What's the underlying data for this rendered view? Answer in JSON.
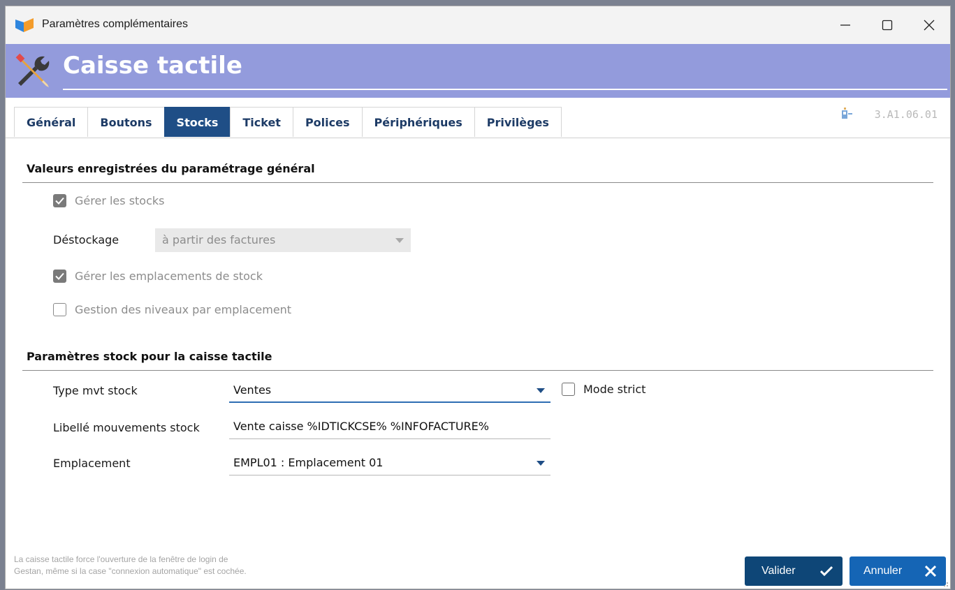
{
  "window": {
    "title": "Paramètres complémentaires"
  },
  "banner": {
    "title": "Caisse tactile"
  },
  "version": "3.A1.06.01",
  "tabs": [
    {
      "label": "Général",
      "active": false
    },
    {
      "label": "Boutons",
      "active": false
    },
    {
      "label": "Stocks",
      "active": true
    },
    {
      "label": "Ticket",
      "active": false
    },
    {
      "label": "Polices",
      "active": false
    },
    {
      "label": "Périphériques",
      "active": false
    },
    {
      "label": "Privilèges",
      "active": false
    }
  ],
  "general_section": {
    "title": "Valeurs enregistrées du paramétrage général",
    "gerer_stocks": {
      "label": "Gérer les stocks",
      "checked": true
    },
    "destockage": {
      "label": "Déstockage",
      "value": "à partir des factures"
    },
    "gerer_emplacements": {
      "label": "Gérer les emplacements de stock",
      "checked": true
    },
    "gestion_niveaux": {
      "label": "Gestion des niveaux par emplacement",
      "checked": false
    }
  },
  "stock_section": {
    "title": "Paramètres stock pour la caisse tactile",
    "type_mvt": {
      "label": "Type mvt stock",
      "value": "Ventes"
    },
    "mode_strict": {
      "label": "Mode strict",
      "checked": false
    },
    "libelle": {
      "label": "Libellé mouvements stock",
      "value": "Vente caisse %IDTICKCSE% %INFOFACTURE%"
    },
    "emplacement": {
      "label": "Emplacement",
      "value": "EMPL01 : Emplacement 01"
    }
  },
  "footer": {
    "note_line1": "La caisse tactile force l'ouverture de la fenêtre de login de",
    "note_line2": "Gestan, même si la case \"connexion automatique\" est cochée.",
    "valider_label": "Valider",
    "annuler_label": "Annuler"
  },
  "colors": {
    "banner": "#939bdc",
    "tab_active": "#1f4e86",
    "valider": "#0e4677",
    "annuler": "#1565b5",
    "focus_underline": "#2d6db3"
  }
}
